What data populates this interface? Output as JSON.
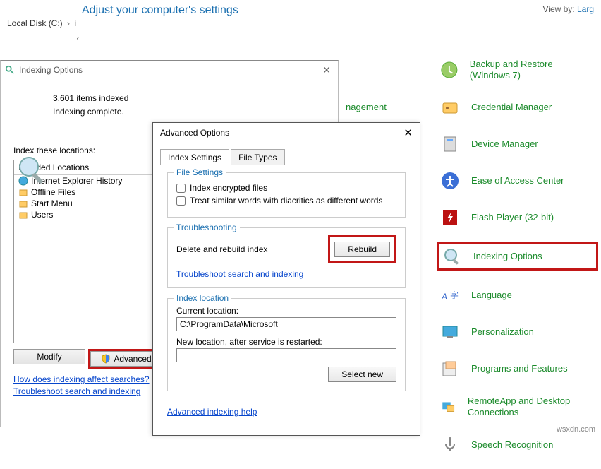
{
  "explorer": {
    "location": "Local Disk (C:)",
    "arrow": "›",
    "hint": "i",
    "chev": "‹"
  },
  "controlPanel": {
    "title": "Adjust your computer's settings",
    "viewByLabel": "View by:",
    "viewByValue": "Larg",
    "items": [
      {
        "label": "Backup and Restore (Windows 7)",
        "icon": "backup-icon"
      },
      {
        "label": "Credential Manager",
        "icon": "credential-icon"
      },
      {
        "label": "Device Manager",
        "icon": "device-icon"
      },
      {
        "label": "Ease of Access Center",
        "icon": "ease-icon"
      },
      {
        "label": "Flash Player (32-bit)",
        "icon": "flash-icon"
      },
      {
        "label": "Indexing Options",
        "icon": "index-icon"
      },
      {
        "label": "Language",
        "icon": "language-icon"
      },
      {
        "label": "Personalization",
        "icon": "personalization-icon"
      },
      {
        "label": "Programs and Features",
        "icon": "programs-icon"
      },
      {
        "label": "RemoteApp and Desktop Connections",
        "icon": "remote-icon"
      },
      {
        "label": "Speech Recognition",
        "icon": "speech-icon"
      }
    ],
    "partial": "nagement"
  },
  "indexing": {
    "windowTitle": "Indexing Options",
    "countLine": "3,601 items indexed",
    "statusLine": "Indexing complete.",
    "locLabel": "Index these locations:",
    "locHeader": "Included Locations",
    "locations": [
      "Internet Explorer History",
      "Offline Files",
      "Start Menu",
      "Users"
    ],
    "modify": "Modify",
    "advanced": "Advanced",
    "link1": "How does indexing affect searches?",
    "link2": "Troubleshoot search and indexing"
  },
  "advanced": {
    "title": "Advanced Options",
    "tabs": [
      "Index Settings",
      "File Types"
    ],
    "fileSettings": {
      "title": "File Settings",
      "encrypt": "Index encrypted files",
      "diacritics": "Treat similar words with diacritics as different words"
    },
    "troubleshooting": {
      "title": "Troubleshooting",
      "desc": "Delete and rebuild index",
      "rebuild": "Rebuild",
      "link": "Troubleshoot search and indexing"
    },
    "indexLocation": {
      "title": "Index location",
      "currentLabel": "Current location:",
      "currentValue": "C:\\ProgramData\\Microsoft",
      "newLabel": "New location, after service is restarted:",
      "newValue": "",
      "selectNew": "Select new"
    },
    "helpLink": "Advanced indexing help"
  },
  "watermark": "wsxdn.com"
}
